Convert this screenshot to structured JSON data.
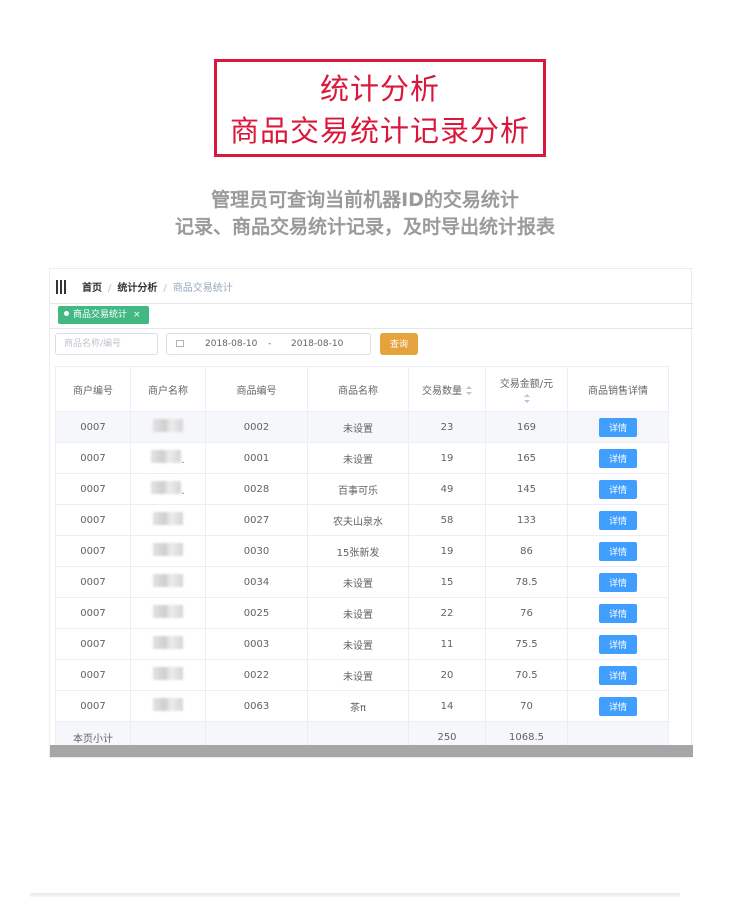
{
  "title": {
    "line1": "统计分析",
    "line2": "商品交易统计记录分析"
  },
  "description": {
    "line1": "管理员可查询当前机器ID的交易统计",
    "line2": "记录、商品交易统计记录，及时导出统计报表"
  },
  "breadcrumb": {
    "home": "首页",
    "section": "统计分析",
    "current": "商品交易统计",
    "separator": "/"
  },
  "tab": {
    "label": "商品交易统计",
    "close": "×"
  },
  "filters": {
    "search_placeholder": "商品名称/编号",
    "date_start": "2018-08-10",
    "date_separator": "-",
    "date_end": "2018-08-10",
    "query_label": "查询"
  },
  "table": {
    "headers": [
      "商户编号",
      "商户名称",
      "商品编号",
      "商品名称",
      "交易数量",
      "交易金额/元",
      "商品销售详情"
    ],
    "rows": [
      {
        "merchant_no": "0007",
        "merchant_name": "",
        "product_no": "0002",
        "product_name": "未设置",
        "qty": "23",
        "amount": "169",
        "detail": "详情"
      },
      {
        "merchant_no": "0007",
        "merchant_name": ".",
        "product_no": "0001",
        "product_name": "未设置",
        "qty": "19",
        "amount": "165",
        "detail": "详情"
      },
      {
        "merchant_no": "0007",
        "merchant_name": ".",
        "product_no": "0028",
        "product_name": "百事可乐",
        "qty": "49",
        "amount": "145",
        "detail": "详情"
      },
      {
        "merchant_no": "0007",
        "merchant_name": "",
        "product_no": "0027",
        "product_name": "农夫山泉水",
        "qty": "58",
        "amount": "133",
        "detail": "详情"
      },
      {
        "merchant_no": "0007",
        "merchant_name": "",
        "product_no": "0030",
        "product_name": "15张新发",
        "qty": "19",
        "amount": "86",
        "detail": "详情"
      },
      {
        "merchant_no": "0007",
        "merchant_name": "",
        "product_no": "0034",
        "product_name": "未设置",
        "qty": "15",
        "amount": "78.5",
        "detail": "详情"
      },
      {
        "merchant_no": "0007",
        "merchant_name": "",
        "product_no": "0025",
        "product_name": "未设置",
        "qty": "22",
        "amount": "76",
        "detail": "详情"
      },
      {
        "merchant_no": "0007",
        "merchant_name": "",
        "product_no": "0003",
        "product_name": "未设置",
        "qty": "11",
        "amount": "75.5",
        "detail": "详情"
      },
      {
        "merchant_no": "0007",
        "merchant_name": "",
        "product_no": "0022",
        "product_name": "未设置",
        "qty": "20",
        "amount": "70.5",
        "detail": "详情"
      },
      {
        "merchant_no": "0007",
        "merchant_name": "",
        "product_no": "0063",
        "product_name": "茶π",
        "qty": "14",
        "amount": "70",
        "detail": "详情"
      }
    ],
    "total": {
      "label": "本页小计",
      "qty": "250",
      "amount": "1068.5"
    }
  },
  "colors": {
    "title_red": "#d9183b",
    "tag_green": "#42b983",
    "query_orange": "#e6a23c",
    "detail_blue": "#409eff"
  }
}
